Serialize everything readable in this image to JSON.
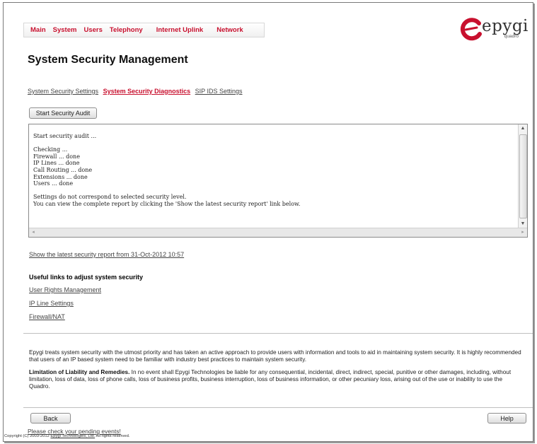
{
  "menu": {
    "items": [
      "Main",
      "System",
      "Users",
      "Telephony",
      "Internet Uplink",
      "Network"
    ]
  },
  "logo": {
    "text": "epygi",
    "sub": "quadro",
    "brand_color": "#c8102e"
  },
  "page": {
    "title": "System Security Management"
  },
  "tabs": [
    {
      "label": "System Security Settings",
      "active": false
    },
    {
      "label": "System Security Diagnostics",
      "active": true
    },
    {
      "label": "SIP IDS Settings",
      "active": false
    }
  ],
  "audit": {
    "button_label": "Start Security Audit",
    "output": "Start security audit ...\n\nChecking ...\nFirewall ... done\nIP Lines ... done\nCall Routing ... done\nExtensions ... done\nUsers ... done\n\nSettings do not correspond to selected security level.\nYou can view the complete report by clicking the 'Show the latest security report' link below."
  },
  "report_link": "Show the latest security report from 31-Oct-2012 10:57",
  "useful": {
    "heading": "Useful links to adjust system security",
    "links": [
      "User Rights Management",
      "IP Line Settings",
      "Firewall/NAT"
    ]
  },
  "notice": {
    "paragraph1": "Epygi treats system security with the utmost priority and has taken an active approach to provide users with information and tools to aid in maintaining system security. It is highly recommended that users of an IP based system need to be familiar with industry best practices to maintain system security.",
    "liability_heading": "Limitation of Liability and Remedies.",
    "liability_text": " In no event shall Epygi Technologies be liable for any consequential, incidental, direct, indirect, special, punitive or other damages, including, without limitation, loss of data, loss of phone calls, loss of business profits, business interruption, loss of business information, or other pecuniary loss, arising out of the use or inability to use the Quadro."
  },
  "footer": {
    "back_label": "Back",
    "help_label": "Help",
    "events_link": "Please check your pending events!",
    "copyright_prefix": "Copyright (C) 2003-2012 ",
    "copyright_company": "Epygi Technologies, Ltd.",
    "copyright_suffix": " All rights reserved."
  }
}
